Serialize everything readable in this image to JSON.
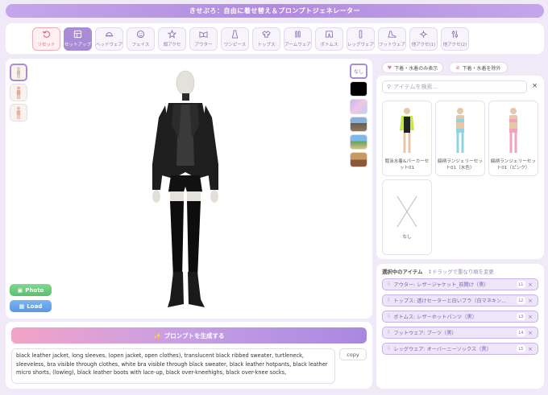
{
  "app": {
    "title": "きせぷろ：自由に着せ替え＆プロンプトジェネレーター"
  },
  "toolbar": {
    "items": [
      {
        "label": "リセット",
        "icon": "reset-icon"
      },
      {
        "label": "セットアップ",
        "icon": "setup-icon"
      },
      {
        "label": "ヘッドウェア",
        "icon": "headwear-icon"
      },
      {
        "label": "フェイス",
        "icon": "face-icon"
      },
      {
        "label": "頭アクセ",
        "icon": "head-accessory-icon"
      },
      {
        "label": "アウター",
        "icon": "outer-icon"
      },
      {
        "label": "ワンピース",
        "icon": "onepiece-icon"
      },
      {
        "label": "トップス",
        "icon": "tops-icon"
      },
      {
        "label": "アームウェア",
        "icon": "armwear-icon"
      },
      {
        "label": "ボトムス",
        "icon": "bottoms-icon"
      },
      {
        "label": "レッグウェア",
        "icon": "legwear-icon"
      },
      {
        "label": "フットウェア",
        "icon": "footwear-icon"
      },
      {
        "label": "他アクセ(1)",
        "icon": "other-accessory-1-icon"
      },
      {
        "label": "他アクセ(2)",
        "icon": "other-accessory-2-icon"
      }
    ],
    "active": "セットアップ"
  },
  "viewer": {
    "background_none_label": "なし"
  },
  "buttons": {
    "photo": "Photo",
    "load": "Load",
    "generate": "プロンプトを生成する",
    "copy": "copy"
  },
  "prompt": {
    "text": "black leather jacket, long sleeves, (open jacket, open clothes), translucent black ribbed sweater, turtleneck, sleeveless, bra visible through clothes, white bra visible through black sweater, black leather hotpants, black leather micro shorts, (lowleg), black leather boots with lace-up, black over-kneehighs, black over-knee socks,"
  },
  "filters": {
    "underwear_only": "下着・水着のみ表示",
    "exclude_underwear": "下着・水着を除外"
  },
  "search": {
    "placeholder": "アイテムを検索..."
  },
  "items": [
    {
      "title": "競泳水着&パーカーセット01"
    },
    {
      "title": "縞柄ランジェリーセット01（水色）"
    },
    {
      "title": "縞柄ランジェリーセット01（ピンク）"
    },
    {
      "title": "なし"
    }
  ],
  "selected": {
    "title": "選択中のアイテム",
    "hint": "↕ドラッグで重なり順を変更",
    "rows": [
      {
        "text": "アウター: レザージャケット_前開け（黒）",
        "level": "L1"
      },
      {
        "text": "トップス: 透けセーターと白いブラ（白マネキン...",
        "level": "L2"
      },
      {
        "text": "ボトムス: レザーホットパンツ（黒）",
        "level": "L3"
      },
      {
        "text": "フットウェア: ブーツ（黒）",
        "level": "L4"
      },
      {
        "text": "レッグウェア: オーバーニーソックス（黒）",
        "level": "L5"
      }
    ]
  },
  "colors": {
    "accent": "#a98bd6",
    "title_bar": "#b28ae0",
    "background": "#efe9f8"
  }
}
